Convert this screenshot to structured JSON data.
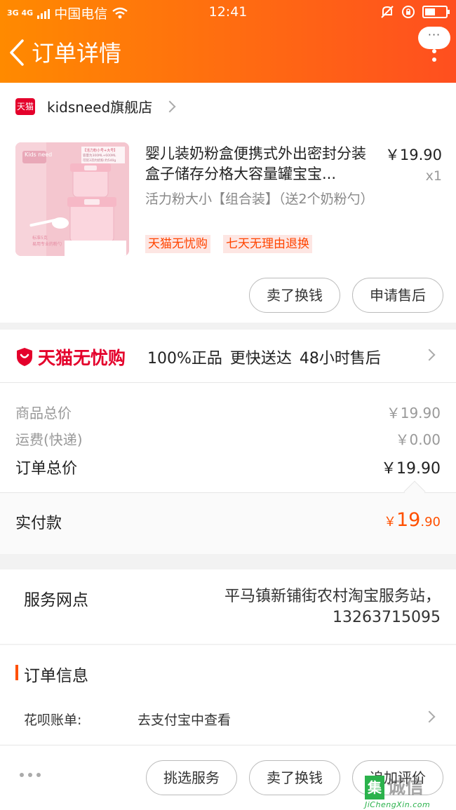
{
  "status_bar": {
    "network": "3G 4G",
    "carrier": "中国电信",
    "time": "12:41"
  },
  "header": {
    "title": "订单详情",
    "menu_bubble": "···"
  },
  "store": {
    "badge": "天猫",
    "name": "kidsneed旗舰店"
  },
  "product": {
    "title": "婴儿装奶粉盒便携式外出密封分装盒子储存分格大容量罐宝宝...",
    "price": "￥19.90",
    "qty": "x1",
    "spec": "活力粉大小【组合装】（送2个奶粉勺）",
    "tags": [
      "天猫无忧购",
      "七天无理由退换"
    ],
    "image": {
      "brand": "Kids need",
      "label_lines": [
        "【活力粉小号+大号】",
        "容量为300ML+600ML",
        "可装3次约奶粉 约540g"
      ],
      "caption_lines": [
        "标准5克",
        "易用专业的粉勺"
      ],
      "colors": {
        "bg": "#f4c6cf",
        "container": "#fbd6de",
        "lid": "#f6b8c6"
      }
    },
    "actions": [
      "卖了换钱",
      "申请售后"
    ]
  },
  "guarantee": {
    "logo_text": "天猫无忧购",
    "description": "100%正品 更快送达 48小时售后"
  },
  "totals": {
    "rows": [
      {
        "label": "商品总价",
        "value": "￥19.90"
      },
      {
        "label": "运费(快递)",
        "value": "￥0.00"
      }
    ],
    "order_total_label": "订单总价",
    "order_total_value": "￥19.90"
  },
  "paid": {
    "label": "实付款",
    "currency": "￥",
    "integer": "19",
    "decimal": ".90"
  },
  "service_point": {
    "label": "服务网点",
    "value_line1": "平马镇新铺街农村淘宝服务站，",
    "value_line2": "13263715095"
  },
  "order_info": {
    "title": "订单信息",
    "huabei_label": "花呗账单:",
    "huabei_value": "去支付宝中查看"
  },
  "bottom_bar": {
    "buttons": [
      "挑选服务",
      "卖了换钱",
      "追加评价"
    ]
  },
  "watermark": {
    "badge": "集",
    "main": "诚信",
    "url": "JiChengXin.com"
  },
  "colors": {
    "accent": "#ff5000",
    "tmall_red": "#e4002b",
    "header_start": "#ff8a00",
    "header_end": "#ff4f1f"
  }
}
